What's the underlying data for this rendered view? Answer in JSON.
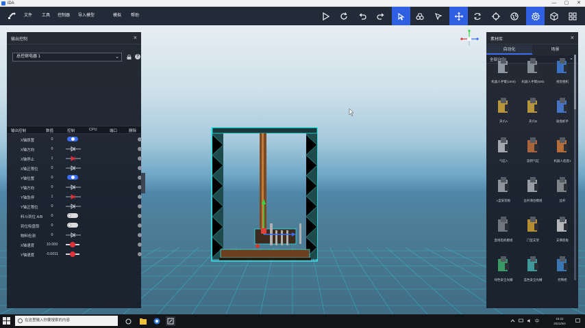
{
  "window": {
    "title": "iDA",
    "controls": [
      "—",
      "▢",
      "✕"
    ]
  },
  "menubar": {
    "items": [
      "文件",
      "工具",
      "控制器",
      "导入模型",
      "模拟",
      "帮助"
    ]
  },
  "toolbar": {
    "tools": [
      {
        "icon": "play-icon",
        "active": false
      },
      {
        "icon": "refresh-icon",
        "active": false
      },
      {
        "icon": "undo-icon",
        "active": false
      },
      {
        "icon": "redo-icon",
        "active": false
      },
      {
        "icon": "select-cursor-icon",
        "active": true
      },
      {
        "icon": "binoculars-icon",
        "active": false
      },
      {
        "icon": "pointer-icon",
        "active": false
      },
      {
        "icon": "move-arrows-icon",
        "active": true
      },
      {
        "icon": "rotate-icon",
        "active": false
      },
      {
        "icon": "crosshair-icon",
        "active": false
      },
      {
        "icon": "globe-icon",
        "active": false
      },
      {
        "icon": "gear-icon",
        "active": true
      },
      {
        "icon": "cube-icon",
        "active": false
      },
      {
        "icon": "grid-icon",
        "active": false
      }
    ]
  },
  "left_panel": {
    "title": "输出控制",
    "selector": "总控继电器 1",
    "columns": [
      "输出控制",
      "数值",
      "控制",
      "CPU",
      "端口",
      "删除"
    ],
    "rows": [
      {
        "name": "X轴原置",
        "value": "0",
        "control": "toggle-on"
      },
      {
        "name": "X轴方向",
        "value": "0",
        "control": "diode"
      },
      {
        "name": "X轴停止",
        "value": "1",
        "control": "diode-red"
      },
      {
        "name": "X轴正限位",
        "value": "0",
        "control": "diode"
      },
      {
        "name": "Y轴位置",
        "value": "0",
        "control": "toggle-on"
      },
      {
        "name": "Y轴方向",
        "value": "0",
        "control": "diode"
      },
      {
        "name": "Y轴急停",
        "value": "1",
        "control": "diode-red"
      },
      {
        "name": "Y轴正限位",
        "value": "0",
        "control": "diode"
      },
      {
        "name": "料斗到位 A/B",
        "value": "0",
        "control": "toggle-off"
      },
      {
        "name": "到位吸盘取",
        "value": "0",
        "control": "toggle-off"
      },
      {
        "name": "物料检测",
        "value": "0",
        "control": "diode"
      },
      {
        "name": "X轴速度",
        "value": "10.000",
        "control": "slider"
      },
      {
        "name": "Y轴速度",
        "value": "-0.0011",
        "control": "slider"
      }
    ]
  },
  "right_panel": {
    "title": "素材库",
    "tabs": [
      {
        "label": "自动化",
        "active": true
      },
      {
        "label": "场景",
        "active": false
      }
    ],
    "category": "全部分类",
    "items": [
      {
        "label": "机器人手臂(1000)",
        "color": "#9aa3ad"
      },
      {
        "label": "机器人手臂(600)",
        "color": "#8e979f"
      },
      {
        "label": "视觉相机",
        "color": "#3f7ad1"
      },
      {
        "label": "夹爪A",
        "color": "#c9a13a"
      },
      {
        "label": "夹爪B",
        "color": "#c6a23e"
      },
      {
        "label": "吸盘抓手",
        "color": "#4a7bd4"
      },
      {
        "label": "气缸A",
        "color": "#b0b5bb"
      },
      {
        "label": "旋转气缸",
        "color": "#b86a3d"
      },
      {
        "label": "机器人底座1",
        "color": "#c4763a"
      },
      {
        "label": "L型安装板",
        "color": "#9aa1a8"
      },
      {
        "label": "丝杆滑台模组",
        "color": "#a6acb2"
      },
      {
        "label": "丝杆",
        "color": "#8b8f93"
      },
      {
        "label": "直线电机模组",
        "color": "#7a8088"
      },
      {
        "label": "门型支架",
        "color": "#c69a35"
      },
      {
        "label": "支撑底板",
        "color": "#c8c8c8"
      },
      {
        "label": "绿色安全光栅",
        "color": "#3ea66b"
      },
      {
        "label": "蓝色安全光栅",
        "color": "#43a6a6"
      },
      {
        "label": "控制柜",
        "color": "#3e7fc0"
      }
    ]
  },
  "taskbar": {
    "search_placeholder": "在这里输入你要搜索的内容",
    "time": "15:22",
    "date": "2021/6/4"
  }
}
